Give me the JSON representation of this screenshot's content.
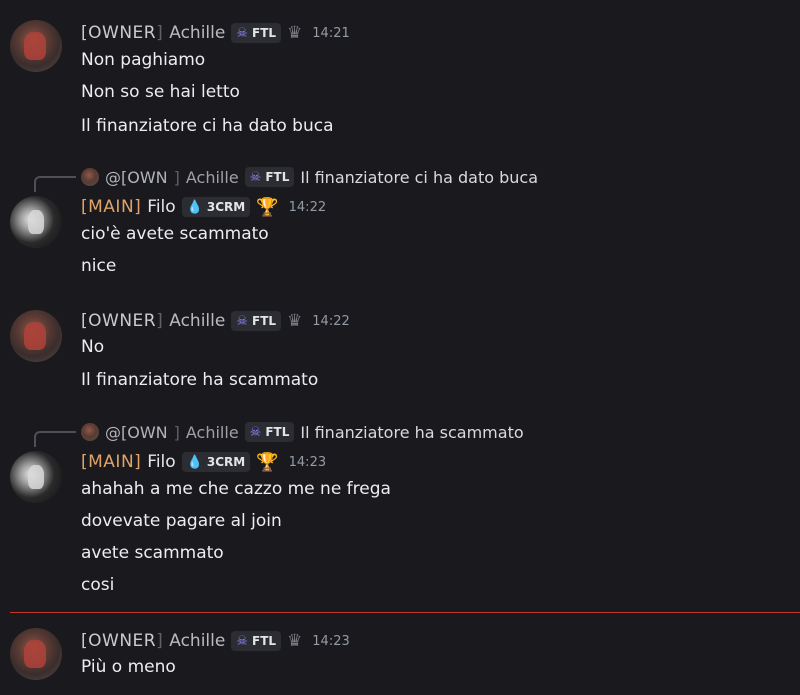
{
  "messages": [
    {
      "author": "Achille",
      "tag_prefix": "[",
      "tag_text": "OWNER",
      "tag_suffix": "]",
      "badge": "FTL",
      "time": "14:21",
      "lines": [
        "Non paghiamo",
        "Non so se hai letto",
        "Il finanziatore ci ha dato buca"
      ]
    },
    {
      "reply_to": {
        "prefix": "@[OWN",
        "suffix": "]",
        "author": "Achille",
        "badge": "FTL",
        "text": "Il finanziatore ci ha dato buca"
      },
      "author": "Filo",
      "tag_text": "[MAIN]",
      "badge": "3CRM",
      "time": "14:22",
      "lines": [
        "cio'è avete scammato",
        "nice"
      ]
    },
    {
      "author": "Achille",
      "tag_prefix": "[",
      "tag_text": "OWNER",
      "tag_suffix": "]",
      "badge": "FTL",
      "time": "14:22",
      "lines": [
        "No",
        "Il finanziatore ha scammato"
      ]
    },
    {
      "reply_to": {
        "prefix": "@[OWN",
        "suffix": "]",
        "author": "Achille",
        "badge": "FTL",
        "text": "Il finanziatore ha scammato"
      },
      "author": "Filo",
      "tag_text": "[MAIN]",
      "badge": "3CRM",
      "time": "14:23",
      "lines": [
        "ahahah a me che cazzo me ne frega",
        "dovevate pagare al join",
        "avete scammato",
        "cosi"
      ]
    },
    {
      "author": "Achille",
      "tag_prefix": "[",
      "tag_text": "OWNER",
      "tag_suffix": "]",
      "badge": "FTL",
      "time": "14:23",
      "lines": [
        "Più o meno"
      ]
    }
  ],
  "colors": {
    "background": "#1a1a1e",
    "new_divider": "#c1392b",
    "main_tag": "#e0a36a"
  }
}
